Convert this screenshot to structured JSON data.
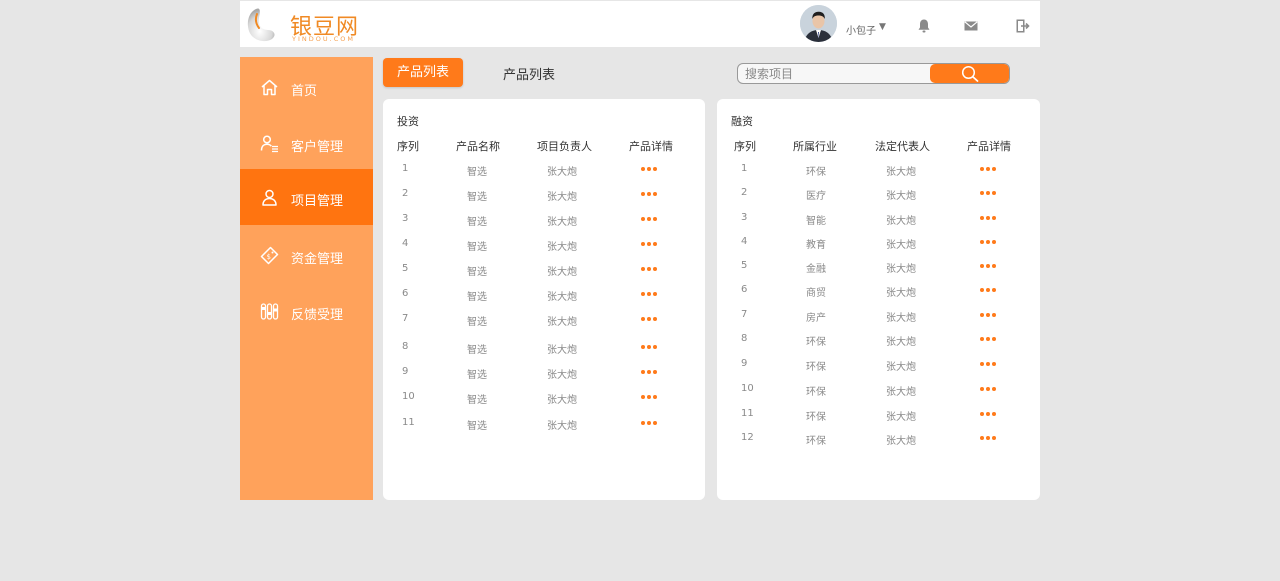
{
  "brand": {
    "name": "银豆网",
    "domain": "YINDOU.COM"
  },
  "header": {
    "username": "小包子",
    "user_caret": "▼",
    "icons": [
      "bell-icon",
      "mail-icon",
      "logout-icon"
    ]
  },
  "sidebar": {
    "items": [
      {
        "label": "首页",
        "icon": "home-icon",
        "active": false
      },
      {
        "label": "客户管理",
        "icon": "customer-icon",
        "active": false
      },
      {
        "label": "项目管理",
        "icon": "user-icon",
        "active": true
      },
      {
        "label": "资金管理",
        "icon": "money-tag-icon",
        "active": false
      },
      {
        "label": "反馈受理",
        "icon": "sliders-icon",
        "active": false
      }
    ]
  },
  "tabs": {
    "active_label": "产品列表",
    "inactive_label": "产品列表"
  },
  "search": {
    "placeholder": "搜索项目"
  },
  "colors": {
    "accent": "#ff7a1a",
    "sidebar": "#ffa25b",
    "sidebar_active": "#ff7410",
    "background": "#e6e6e6"
  },
  "invest": {
    "title": "投资",
    "headers": [
      "序列",
      "产品名称",
      "项目负责人",
      "产品详情"
    ],
    "rows": [
      {
        "no": "1",
        "name": "智选",
        "owner": "张大炮"
      },
      {
        "no": "2",
        "name": "智选",
        "owner": "张大炮"
      },
      {
        "no": "3",
        "name": "智选",
        "owner": "张大炮"
      },
      {
        "no": "4",
        "name": "智选",
        "owner": "张大炮"
      },
      {
        "no": "5",
        "name": "智选",
        "owner": "张大炮"
      },
      {
        "no": "6",
        "name": "智选",
        "owner": "张大炮"
      },
      {
        "no": "7",
        "name": "智选",
        "owner": "张大炮"
      },
      {
        "no": "8",
        "name": "智选",
        "owner": "张大炮"
      },
      {
        "no": "9",
        "name": "智选",
        "owner": "张大炮"
      },
      {
        "no": "10",
        "name": "智选",
        "owner": "张大炮"
      },
      {
        "no": "11",
        "name": "智选",
        "owner": "张大炮"
      }
    ]
  },
  "finance": {
    "title": "融资",
    "headers": [
      "序列",
      "所属行业",
      "法定代表人",
      "产品详情"
    ],
    "rows": [
      {
        "no": "1",
        "industry": "环保",
        "rep": "张大炮"
      },
      {
        "no": "2",
        "industry": "医疗",
        "rep": "张大炮"
      },
      {
        "no": "3",
        "industry": "智能",
        "rep": "张大炮"
      },
      {
        "no": "4",
        "industry": "教育",
        "rep": "张大炮"
      },
      {
        "no": "5",
        "industry": "金融",
        "rep": "张大炮"
      },
      {
        "no": "6",
        "industry": "商贸",
        "rep": "张大炮"
      },
      {
        "no": "7",
        "industry": "房产",
        "rep": "张大炮"
      },
      {
        "no": "8",
        "industry": "环保",
        "rep": "张大炮"
      },
      {
        "no": "9",
        "industry": "环保",
        "rep": "张大炮"
      },
      {
        "no": "10",
        "industry": "环保",
        "rep": "张大炮"
      },
      {
        "no": "11",
        "industry": "环保",
        "rep": "张大炮"
      },
      {
        "no": "12",
        "industry": "环保",
        "rep": "张大炮"
      }
    ]
  }
}
